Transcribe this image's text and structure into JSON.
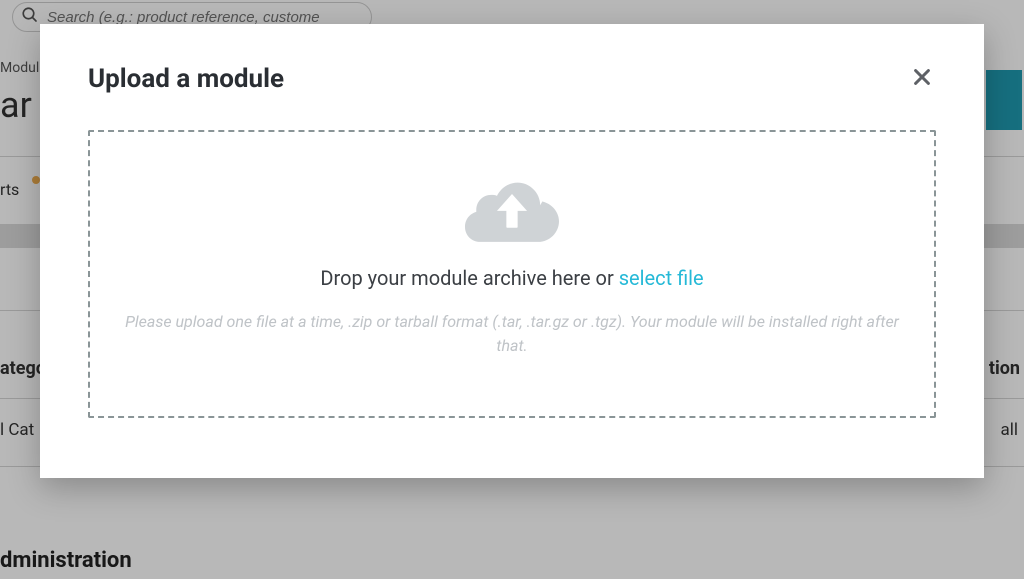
{
  "page": {
    "search_placeholder": "Search (e.g.: product reference, custome",
    "breadcrumb": "Modul",
    "title_fragment": "ar",
    "tab_label": "rts",
    "filter_category_label": "atego",
    "filter_category_value": "l Cat",
    "filter_action_label": "tion",
    "filter_action_value": "all",
    "section_heading": "dministration"
  },
  "modal": {
    "title": "Upload a module",
    "drop_text": "Drop your module archive here or ",
    "select_file": "select file",
    "help_text": "Please upload one file at a time, .zip or tarball format (.tar, .tar.gz or .tgz). Your module will be installed right after that."
  }
}
